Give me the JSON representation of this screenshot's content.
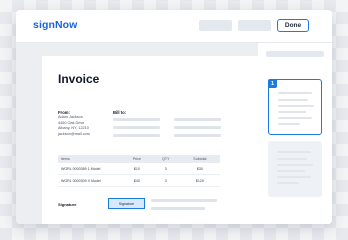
{
  "header": {
    "logo": "signNow",
    "done_label": "Done"
  },
  "invoice": {
    "title": "Invoice",
    "from_label": "From:",
    "from_lines": [
      "Adam Jackson",
      "4450 Oak Drive",
      "Albany, NY, 12210",
      "jackson@mail.com"
    ],
    "bill_to_label": "Bill to:",
    "table": {
      "headers": [
        "Items",
        "Price",
        "QTY",
        "Subtotal"
      ],
      "rows": [
        [
          "WGRL 0000389 1 Model",
          "$10",
          "3",
          "$30"
        ],
        [
          "WGRL 0000309 X Model",
          "$40",
          "3",
          "$120"
        ]
      ]
    },
    "signature_label": "Signature",
    "signature_field": "Signature"
  },
  "sidebar": {
    "active_page": "1"
  },
  "colors": {
    "accent": "#1f7ae0",
    "brand": "#1565d8",
    "signature_fill": "#d8e9fb"
  }
}
